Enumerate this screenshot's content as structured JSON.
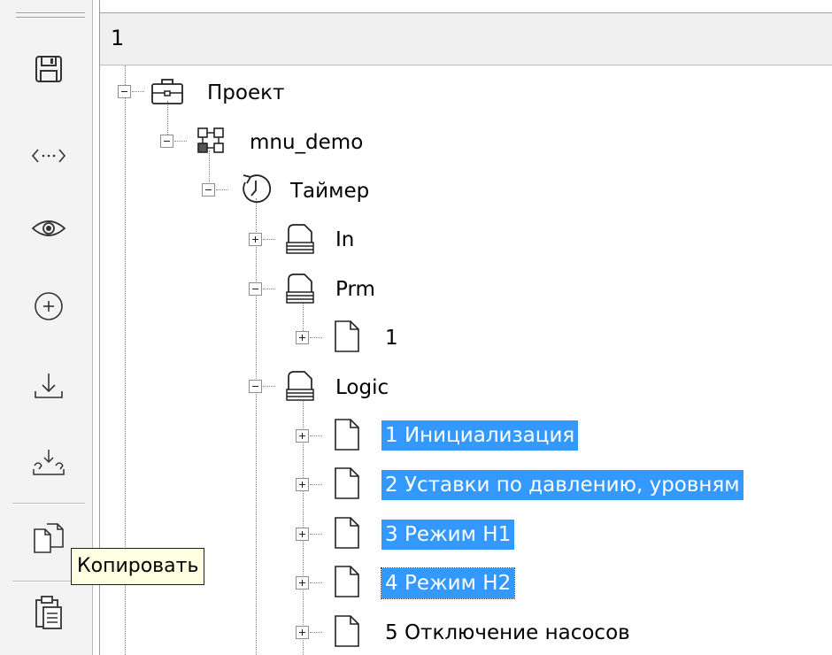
{
  "header": {
    "text": "1"
  },
  "toolbar": {
    "buttons": [
      {
        "name": "save-button",
        "icon": "floppy-disk-icon"
      },
      {
        "name": "code-button",
        "icon": "code-brackets-icon"
      },
      {
        "name": "view-button",
        "icon": "eye-icon"
      },
      {
        "name": "add-button",
        "icon": "plus-circle-icon"
      },
      {
        "name": "download-button",
        "icon": "download-icon"
      },
      {
        "name": "import-button",
        "icon": "import-icon"
      },
      {
        "name": "copy-button",
        "icon": "copy-icon"
      },
      {
        "name": "paste-button",
        "icon": "clipboard-icon"
      }
    ]
  },
  "tooltip": {
    "text": "Копировать"
  },
  "tree": {
    "nodes": [
      {
        "label": "Проект",
        "icon": "briefcase-icon",
        "expanded": true
      },
      {
        "label": "mnu_demo",
        "icon": "network-icon",
        "expanded": true
      },
      {
        "label": "Таймер",
        "icon": "timer-icon",
        "expanded": true
      },
      {
        "label": "In",
        "icon": "stack-icon",
        "expanded": false
      },
      {
        "label": "Prm",
        "icon": "stack-icon",
        "expanded": true
      },
      {
        "label": "1",
        "icon": "document-icon",
        "expanded": false
      },
      {
        "label": "Logic",
        "icon": "stack-icon",
        "expanded": true
      },
      {
        "label": "1 Инициализация",
        "icon": "document-icon",
        "expanded": false,
        "selected": true
      },
      {
        "label": "2 Уставки по давлению, уровням",
        "icon": "document-icon",
        "expanded": false,
        "selected": true
      },
      {
        "label": "3 Режим Н1",
        "icon": "document-icon",
        "expanded": false,
        "selected": true
      },
      {
        "label": "4 Режим Н2",
        "icon": "document-icon",
        "expanded": false,
        "selected": true,
        "focused": true
      },
      {
        "label": "5 Отключение насосов",
        "icon": "document-icon",
        "expanded": false
      }
    ]
  },
  "colors": {
    "selection": "#3399ff",
    "tooltip_bg": "#ffffe1"
  }
}
